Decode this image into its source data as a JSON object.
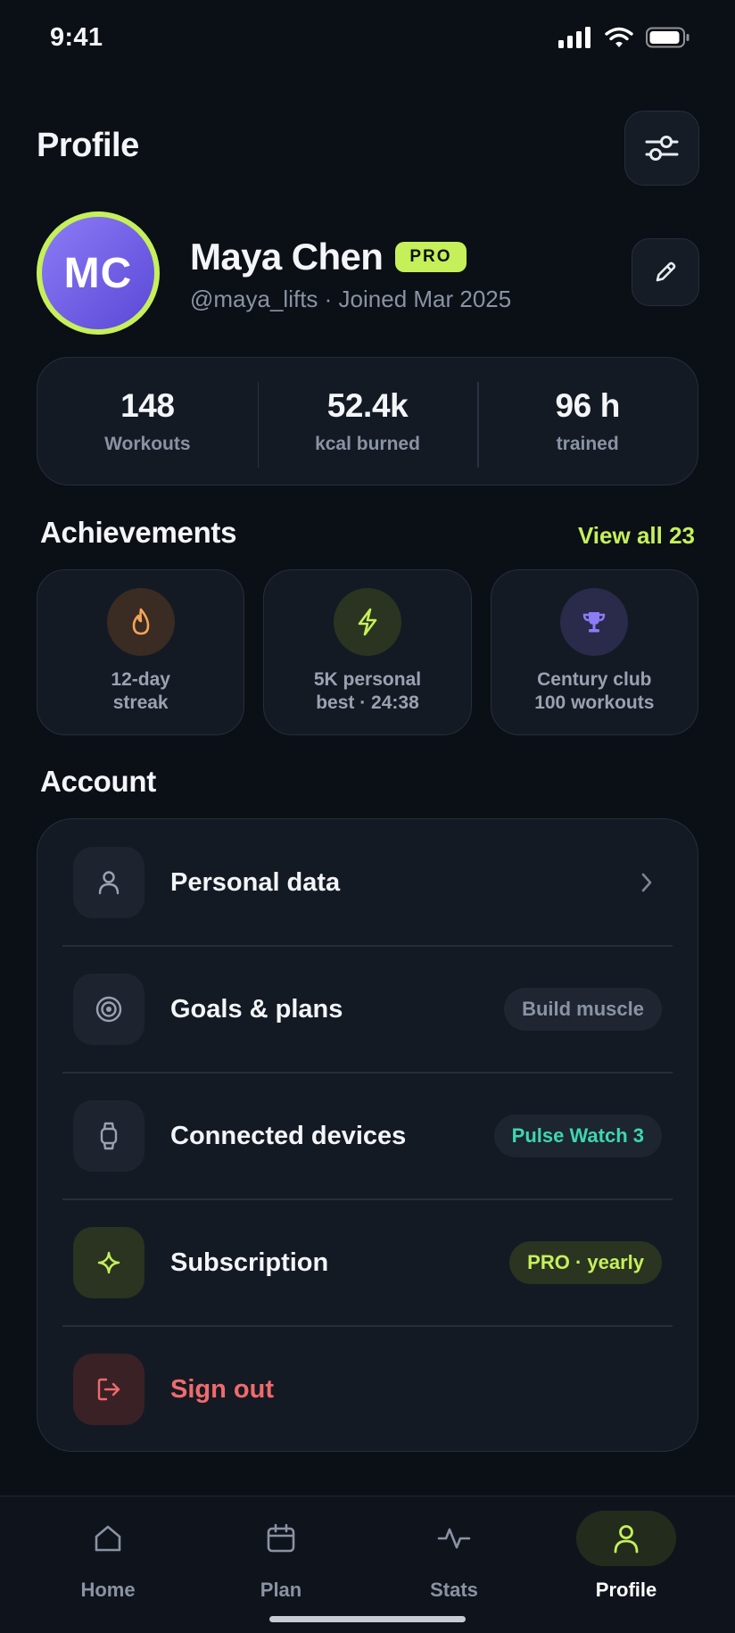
{
  "status": {
    "time": "9:41"
  },
  "header": {
    "title": "Profile"
  },
  "profile": {
    "initials": "MC",
    "name": "Maya Chen",
    "badge": "PRO",
    "meta": "@maya_lifts · Joined Mar 2025"
  },
  "stats": [
    {
      "value": "148",
      "label": "Workouts"
    },
    {
      "value": "52.4k",
      "label": "kcal burned"
    },
    {
      "value": "96 h",
      "label": "trained"
    }
  ],
  "achievements": {
    "title": "Achievements",
    "view_all": "View all 23",
    "items": [
      {
        "label": "12-day\nstreak",
        "icon": "flame-icon",
        "color": "#f5a45a"
      },
      {
        "label": "5K personal\nbest · 24:38",
        "icon": "bolt-icon",
        "color": "#c5f05a"
      },
      {
        "label": "Century club\n100 workouts",
        "icon": "trophy-icon",
        "color": "#8c7cf6"
      }
    ]
  },
  "account": {
    "title": "Account",
    "rows": [
      {
        "label": "Personal data",
        "icon": "user-icon"
      },
      {
        "label": "Goals & plans",
        "icon": "target-icon",
        "pill": "Build muscle"
      },
      {
        "label": "Connected devices",
        "icon": "watch-icon",
        "pill": "Pulse Watch 3"
      },
      {
        "label": "Subscription",
        "icon": "sparkle-icon",
        "pill": "PRO · yearly"
      },
      {
        "label": "Sign out",
        "icon": "logout-icon"
      }
    ]
  },
  "nav": [
    {
      "label": "Home",
      "icon": "home-icon"
    },
    {
      "label": "Plan",
      "icon": "calendar-icon"
    },
    {
      "label": "Stats",
      "icon": "activity-icon"
    },
    {
      "label": "Profile",
      "icon": "profile-icon",
      "active": true
    }
  ],
  "colors": {
    "accent": "#c5f05a",
    "background": "#0b0f16",
    "card": "#141a24",
    "teal": "#3ed6b0",
    "danger": "#f06b6b"
  }
}
